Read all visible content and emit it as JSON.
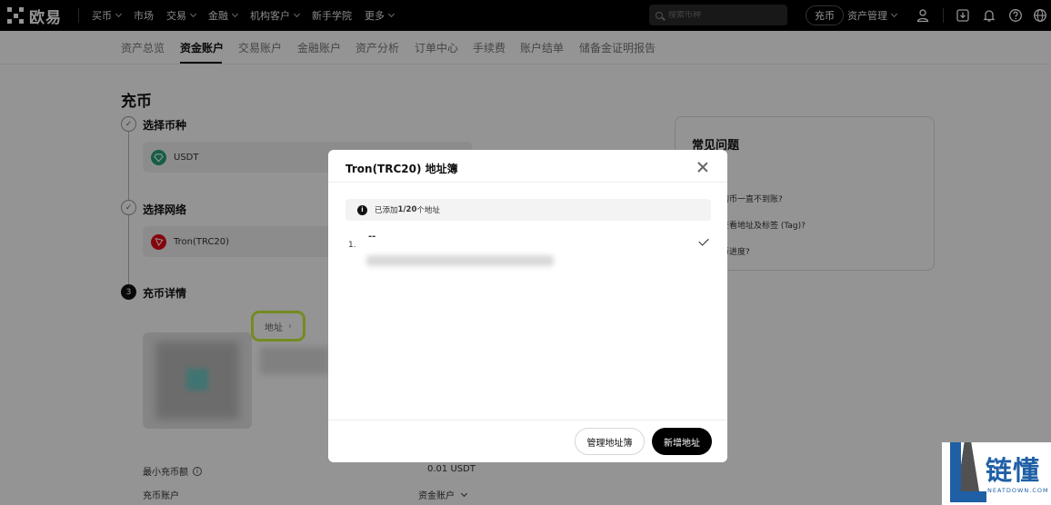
{
  "topnav": {
    "logo_text": "欧易",
    "items": [
      {
        "label": "买币",
        "dropdown": true
      },
      {
        "label": "市场",
        "dropdown": false
      },
      {
        "label": "交易",
        "dropdown": true
      },
      {
        "label": "金融",
        "dropdown": true
      },
      {
        "label": "机构客户",
        "dropdown": true
      },
      {
        "label": "新手学院",
        "dropdown": false
      },
      {
        "label": "更多",
        "dropdown": true
      }
    ],
    "search_placeholder": "搜索币种",
    "deposit_label": "充币",
    "asset_mgmt_label": "资产管理"
  },
  "subnav": {
    "items": [
      "资产总览",
      "资金账户",
      "交易账户",
      "金融账户",
      "资产分析",
      "订单中心",
      "手续费",
      "账户结单",
      "储备金证明报告"
    ],
    "active": "资金账户"
  },
  "page": {
    "title": "充币",
    "steps": [
      {
        "num": "1",
        "label": "选择币种",
        "done": true
      },
      {
        "num": "2",
        "label": "选择网络",
        "done": true
      },
      {
        "num": "3",
        "label": "充币详情",
        "done": false
      }
    ],
    "coin": "USDT",
    "network": "Tron(TRC20)",
    "address_tab": "地址",
    "min_deposit_label": "最小充币额",
    "min_deposit_value": "0.01 USDT",
    "deposit_account_label": "充币账户",
    "deposit_account_value": "资金账户"
  },
  "faq": {
    "title": "常见问题",
    "items": [
      "的币一直不到账?",
      "查看地址及标签 (Tag)?",
      "币进度?"
    ]
  },
  "modal": {
    "title": "Tron(TRC20) 地址簿",
    "notice_prefix": "已添加 ",
    "notice_count": "1/20",
    "notice_suffix": " 个地址",
    "entries": [
      {
        "index": "1.",
        "label": "--",
        "selected": true
      }
    ],
    "manage_button": "管理地址簿",
    "add_button": "新增地址"
  },
  "watermark": {
    "cn": "链懂",
    "en": "NEATDOWN.COM"
  },
  "colors": {
    "highlight": "#c8ef3a",
    "nav_bg": "#000000",
    "primary_button": "#000000",
    "usdt": "#26a17b",
    "tron": "#e50915"
  }
}
